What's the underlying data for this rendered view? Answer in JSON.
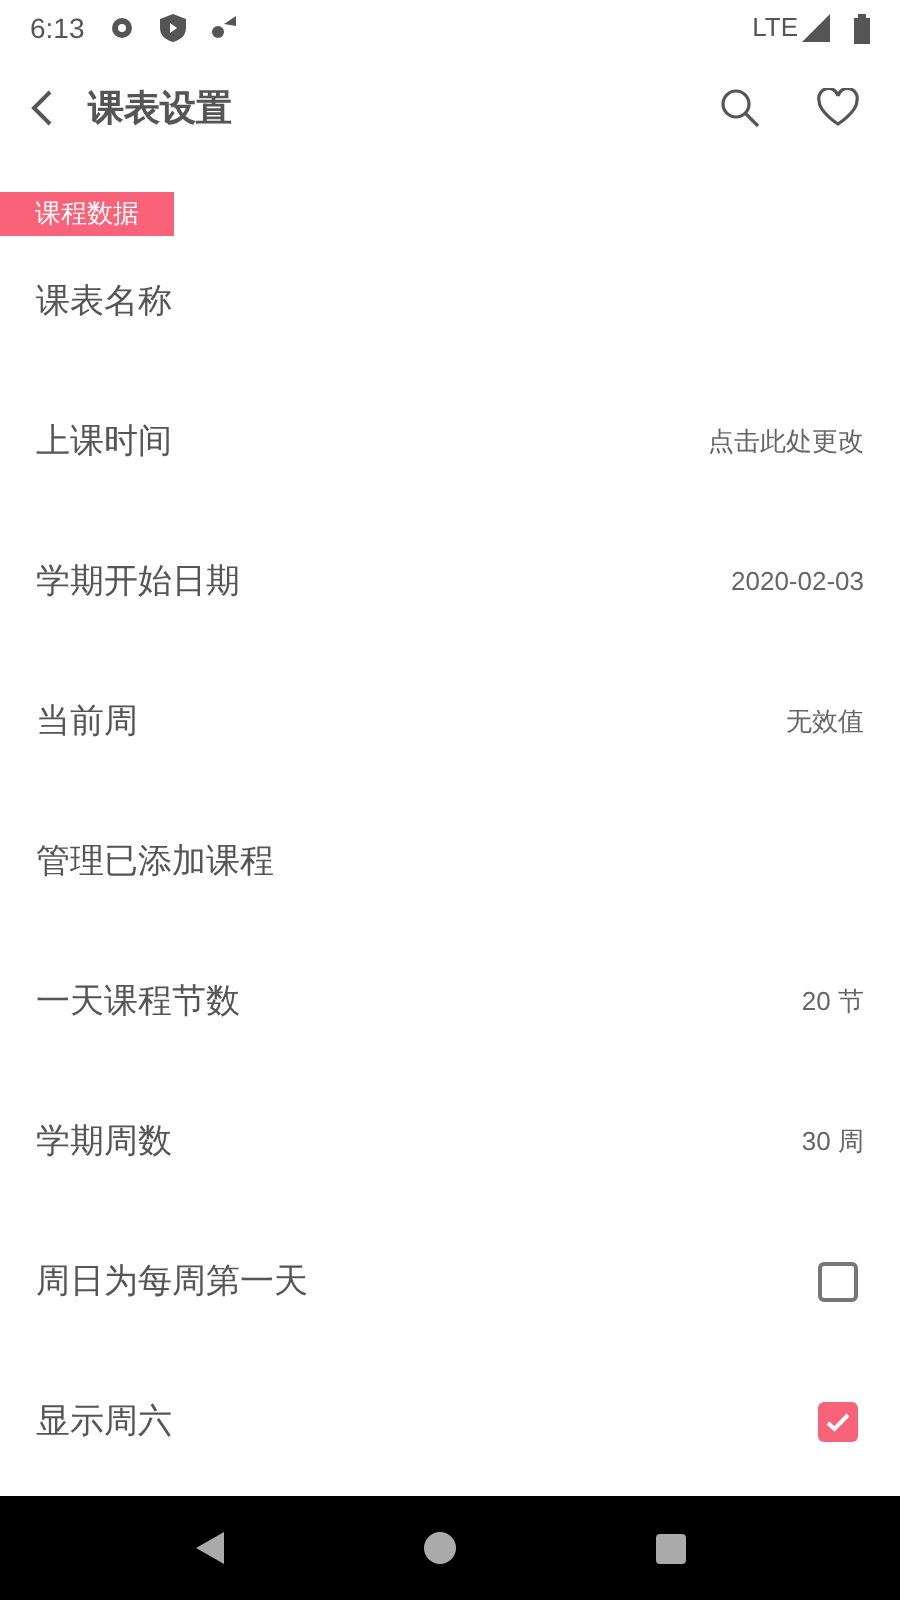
{
  "status_bar": {
    "time": "6:13",
    "network": "LTE"
  },
  "app_bar": {
    "title": "课表设置"
  },
  "section": {
    "label": "课程数据"
  },
  "rows": [
    {
      "kind": "plain",
      "label": "课表名称"
    },
    {
      "kind": "value",
      "label": "上课时间",
      "value": "点击此处更改"
    },
    {
      "kind": "value",
      "label": "学期开始日期",
      "value": "2020-02-03"
    },
    {
      "kind": "value",
      "label": "当前周",
      "value": "无效值"
    },
    {
      "kind": "plain",
      "label": "管理已添加课程"
    },
    {
      "kind": "value",
      "label": "一天课程节数",
      "value": "20 节"
    },
    {
      "kind": "value",
      "label": "学期周数",
      "value": "30 周"
    },
    {
      "kind": "checkbox",
      "label": "周日为每周第一天",
      "checked": false
    },
    {
      "kind": "checkbox",
      "label": "显示周六",
      "checked": true
    }
  ]
}
